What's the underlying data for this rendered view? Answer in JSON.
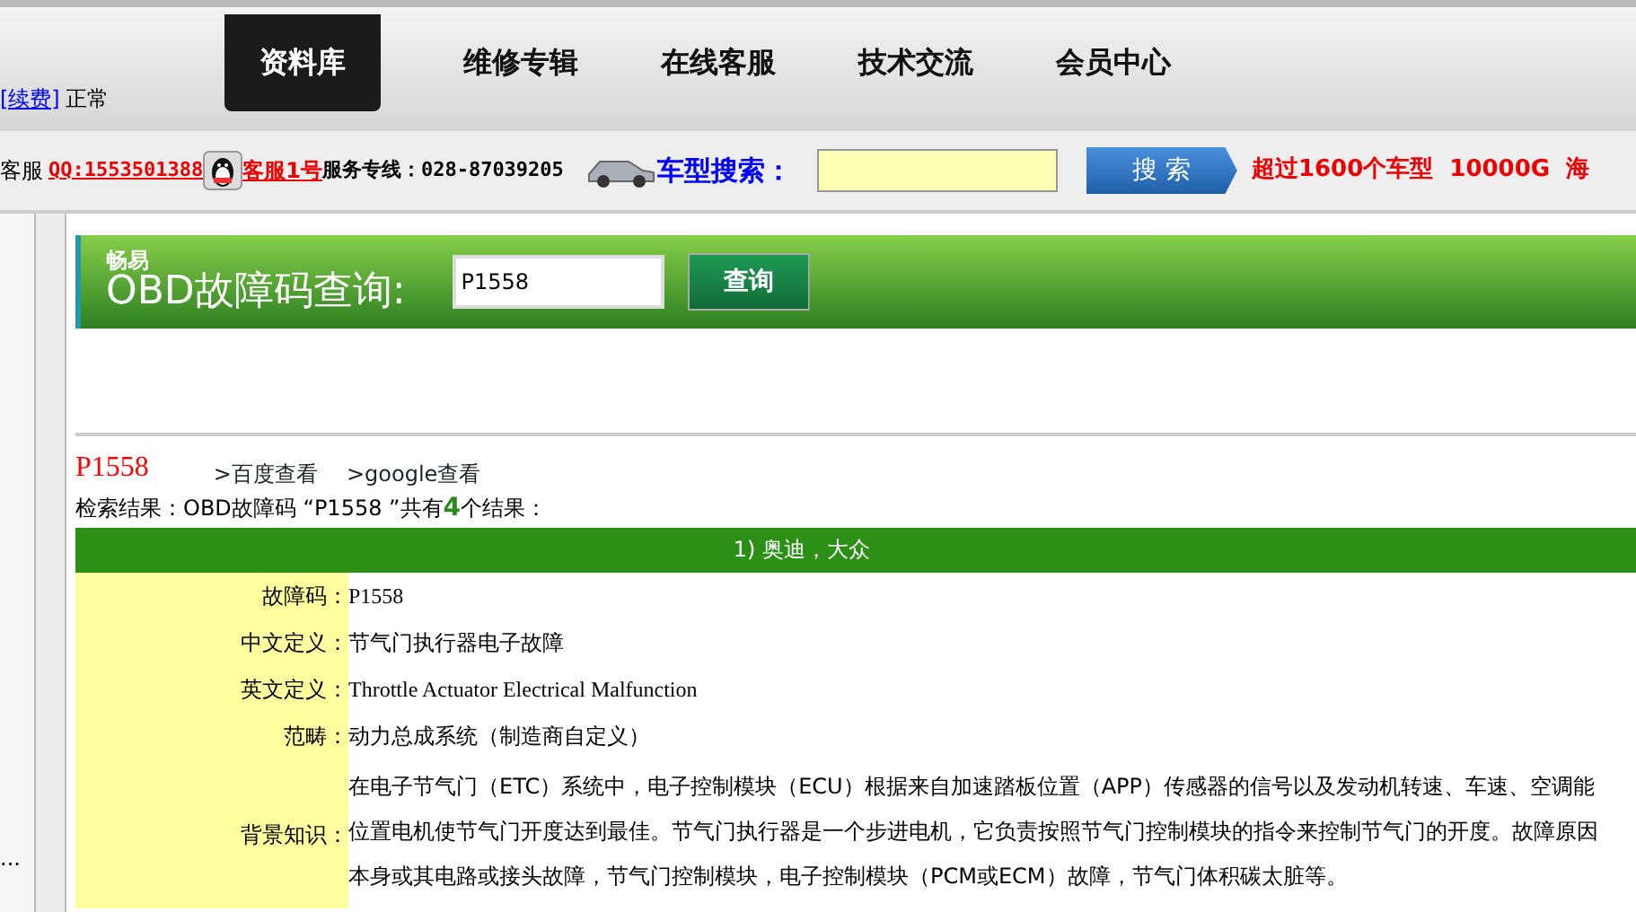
{
  "top_nav": {
    "renew_link": "[续费]",
    "account_status": "正常",
    "tabs": [
      {
        "label": "资料库",
        "selected": true
      },
      {
        "label": "维修专辑",
        "selected": false
      },
      {
        "label": "在线客服",
        "selected": false
      },
      {
        "label": "技术交流",
        "selected": false
      },
      {
        "label": "会员中心",
        "selected": false
      }
    ]
  },
  "info_bar": {
    "service_label": "客服",
    "qq": "QQ:1553501388",
    "service_link": "客服1号",
    "hotline": "服务专线：028-87039205",
    "search_label": "车型搜索：",
    "search_button": "搜 索",
    "promo": "超过1600个车型  10000G  海"
  },
  "sidebar": {
    "more": "..."
  },
  "obd_banner": {
    "brand": "畅易",
    "title": "OBD故障码查询:",
    "query": "P1558",
    "button": "查询"
  },
  "result": {
    "code": "P1558",
    "links": [
      ">百度查看",
      ">google查看"
    ],
    "summary": "检索结果：OBD故障码 “P1558 ”共有**4**个结果："
  },
  "entries": [
    {
      "header": "1) 奥迪，大众",
      "fields": [
        {
          "label": "故障码：",
          "kind": "serif",
          "lines": [
            "P1558"
          ]
        },
        {
          "label": "中文定义：",
          "kind": "plain",
          "lines": [
            "节气门执行器电子故障"
          ]
        },
        {
          "label": "英文定义：",
          "kind": "serif",
          "lines": [
            "Throttle Actuator Electrical Malfunction"
          ]
        },
        {
          "label": "范畴：",
          "kind": "plain",
          "lines": [
            "动力总成系统（制造商自定义）"
          ]
        },
        {
          "label": "背景知识：",
          "kind": "plain",
          "lines": [
            "在电子节气门（ETC）系统中，电子控制模块（ECU）根据来自加速踏板位置（APP）传感器的信号以及发动机转速、车速、空调能",
            "位置电机使节气门开度达到最佳。节气门执行器是一个步进电机，它负责按照节气门控制模块的指令来控制节气门的开度。故障原因",
            "本身或其电路或接头故障，节气门控制模块，电子控制模块（PCM或ECM）故障，节气门体积碳太脏等。"
          ]
        }
      ]
    }
  ]
}
